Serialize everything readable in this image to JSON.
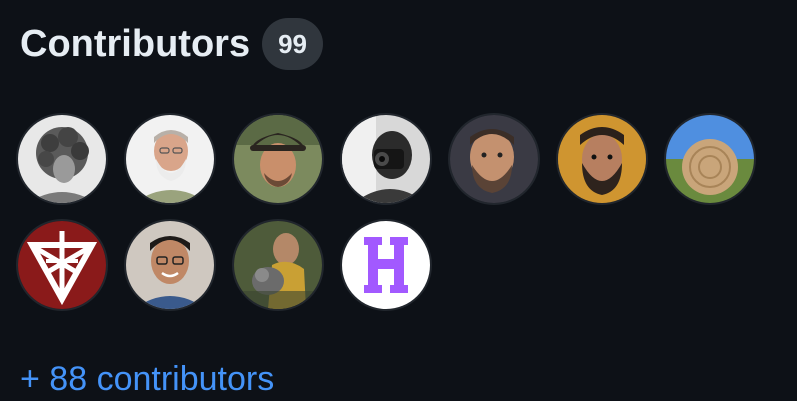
{
  "header": {
    "title": "Contributors",
    "count": "99"
  },
  "avatars": [
    {
      "name": "avatar-1",
      "icon": "person-curly-hair-bw"
    },
    {
      "name": "avatar-2",
      "icon": "person-white-beard"
    },
    {
      "name": "avatar-3",
      "icon": "person-hat"
    },
    {
      "name": "avatar-4",
      "icon": "person-camera-bw"
    },
    {
      "name": "avatar-5",
      "icon": "person-bearded"
    },
    {
      "name": "avatar-6",
      "icon": "person-dark-beard"
    },
    {
      "name": "avatar-7",
      "icon": "hay-bale-sky"
    },
    {
      "name": "avatar-8",
      "icon": "geometric-triangle-logo"
    },
    {
      "name": "avatar-9",
      "icon": "person-smiling-glasses"
    },
    {
      "name": "avatar-10",
      "icon": "person-with-dog"
    },
    {
      "name": "avatar-11",
      "icon": "letter-h-logo"
    }
  ],
  "more_link": "+ 88 contributors",
  "colors": {
    "background": "#0d1117",
    "title": "#e6edf3",
    "badge_bg": "#30363d",
    "link": "#4493f8",
    "h_logo": "#a259ff"
  }
}
